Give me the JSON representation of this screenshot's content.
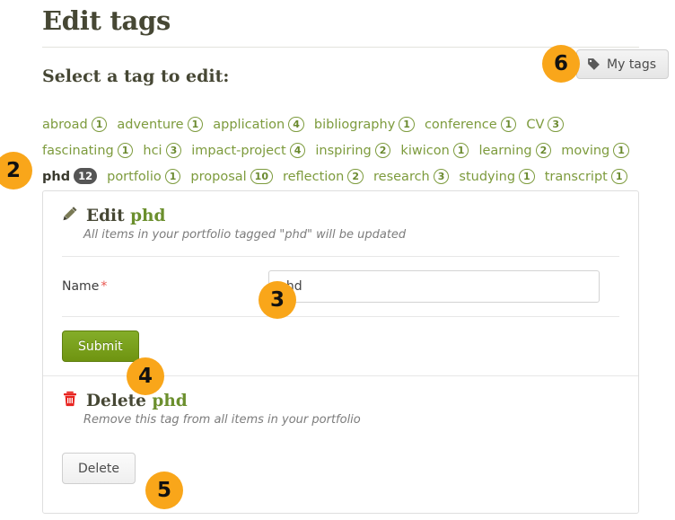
{
  "page": {
    "title": "Edit tags",
    "section_heading": "Select a tag to edit:"
  },
  "header": {
    "my_tags_label": "My tags",
    "my_tags_icon": "tag-icon"
  },
  "tag_cloud": {
    "current_tag": "phd",
    "tags": [
      {
        "label": "abroad",
        "count": "1",
        "current": false
      },
      {
        "label": "adventure",
        "count": "1",
        "current": false
      },
      {
        "label": "application",
        "count": "4",
        "current": false
      },
      {
        "label": "bibliography",
        "count": "1",
        "current": false
      },
      {
        "label": "conference",
        "count": "1",
        "current": false
      },
      {
        "label": "CV",
        "count": "3",
        "current": false
      },
      {
        "label": "fascinating",
        "count": "1",
        "current": false
      },
      {
        "label": "hci",
        "count": "3",
        "current": false
      },
      {
        "label": "impact-project",
        "count": "4",
        "current": false
      },
      {
        "label": "inspiring",
        "count": "2",
        "current": false
      },
      {
        "label": "kiwicon",
        "count": "1",
        "current": false
      },
      {
        "label": "learning",
        "count": "2",
        "current": false
      },
      {
        "label": "moving",
        "count": "1",
        "current": false
      },
      {
        "label": "phd",
        "count": "12",
        "current": true
      },
      {
        "label": "portfolio",
        "count": "1",
        "current": false
      },
      {
        "label": "proposal",
        "count": "10",
        "current": false
      },
      {
        "label": "reflection",
        "count": "2",
        "current": false
      },
      {
        "label": "research",
        "count": "3",
        "current": false
      },
      {
        "label": "studying",
        "count": "1",
        "current": false
      },
      {
        "label": "transcript",
        "count": "1",
        "current": false
      }
    ]
  },
  "edit_panel": {
    "icon": "pencil-icon",
    "heading_prefix": "Edit",
    "heading_tag": "phd",
    "description": "All items in your portfolio tagged \"phd\" will be updated",
    "name_label": "Name",
    "name_required_mark": "*",
    "name_value": "phd",
    "name_placeholder": "",
    "submit_label": "Submit"
  },
  "delete_panel": {
    "icon": "trash-icon",
    "heading_prefix": "Delete",
    "heading_tag": "phd",
    "description": "Remove this tag from all items in your portfolio",
    "delete_label": "Delete"
  },
  "markers": [
    {
      "id": "marker-2",
      "number": "2"
    },
    {
      "id": "marker-3",
      "number": "3"
    },
    {
      "id": "marker-4",
      "number": "4"
    },
    {
      "id": "marker-5",
      "number": "5"
    },
    {
      "id": "marker-6",
      "number": "6"
    }
  ],
  "colors": {
    "tag_link": "#7d9b3d",
    "heading": "#464734",
    "tag_name_green": "#6b8f2d",
    "marker_orange": "#f9a61a",
    "submit_green": "#79a11c",
    "required_red": "#e8564f",
    "trash_red": "#e8231f",
    "current_badge": "#555555"
  }
}
